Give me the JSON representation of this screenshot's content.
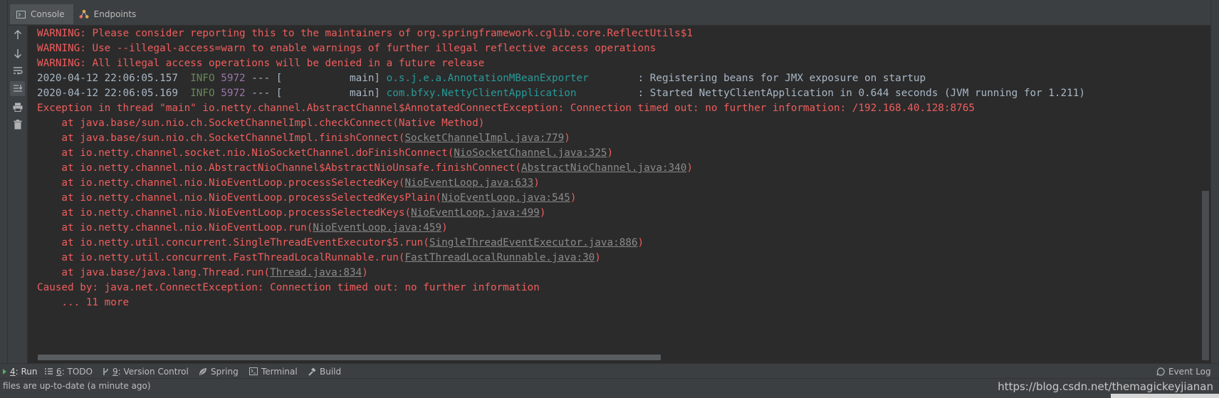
{
  "tabs": [
    {
      "label": "Console",
      "icon": "console-icon"
    },
    {
      "label": "Endpoints",
      "icon": "endpoints-icon"
    }
  ],
  "sidebar_icons": [
    "arrow-up-icon",
    "arrow-down-icon",
    "soft-wrap-icon",
    "scroll-to-end-icon",
    "print-icon",
    "trash-icon"
  ],
  "console_lines": [
    [
      {
        "t": "WARNING: Please consider reporting this to the maintainers of org.springframework.cglib.core.ReflectUtils$1",
        "c": "err"
      }
    ],
    [
      {
        "t": "WARNING: Use --illegal-access=warn to enable warnings of further illegal reflective access operations",
        "c": "err"
      }
    ],
    [
      {
        "t": "WARNING: All illegal access operations will be denied in a future release",
        "c": "err"
      }
    ],
    [
      {
        "t": "2020-04-12 22:06:05.157  ",
        "c": ""
      },
      {
        "t": "INFO",
        "c": "info"
      },
      {
        "t": " ",
        "c": ""
      },
      {
        "t": "5972",
        "c": "pid"
      },
      {
        "t": " --- [           main] ",
        "c": ""
      },
      {
        "t": "o.s.j.e.a.AnnotationMBeanExporter       ",
        "c": "logger"
      },
      {
        "t": " : Registering beans for JMX exposure on startup",
        "c": ""
      }
    ],
    [
      {
        "t": "2020-04-12 22:06:05.169  ",
        "c": ""
      },
      {
        "t": "INFO",
        "c": "info"
      },
      {
        "t": " ",
        "c": ""
      },
      {
        "t": "5972",
        "c": "pid"
      },
      {
        "t": " --- [           main] ",
        "c": ""
      },
      {
        "t": "com.bfxy.NettyClientApplication         ",
        "c": "logger"
      },
      {
        "t": " : Started NettyClientApplication in 0.644 seconds (JVM running for 1.211)",
        "c": ""
      }
    ],
    [
      {
        "t": "Exception in thread \"main\" io.netty.channel.AbstractChannel$AnnotatedConnectException: Connection timed out: no further information: /192.168.40.128:8765",
        "c": "err"
      }
    ],
    [
      {
        "t": "    at java.base/sun.nio.ch.SocketChannelImpl.checkConnect(Native Method)",
        "c": "err"
      }
    ],
    [
      {
        "t": "    at java.base/sun.nio.ch.SocketChannelImpl.finishConnect(",
        "c": "err"
      },
      {
        "t": "SocketChannelImpl.java:779",
        "c": "link"
      },
      {
        "t": ")",
        "c": "err"
      }
    ],
    [
      {
        "t": "    at io.netty.channel.socket.nio.NioSocketChannel.doFinishConnect(",
        "c": "err"
      },
      {
        "t": "NioSocketChannel.java:325",
        "c": "link"
      },
      {
        "t": ")",
        "c": "err"
      }
    ],
    [
      {
        "t": "    at io.netty.channel.nio.AbstractNioChannel$AbstractNioUnsafe.finishConnect(",
        "c": "err"
      },
      {
        "t": "AbstractNioChannel.java:340",
        "c": "link"
      },
      {
        "t": ")",
        "c": "err"
      }
    ],
    [
      {
        "t": "    at io.netty.channel.nio.NioEventLoop.processSelectedKey(",
        "c": "err"
      },
      {
        "t": "NioEventLoop.java:633",
        "c": "link"
      },
      {
        "t": ")",
        "c": "err"
      }
    ],
    [
      {
        "t": "    at io.netty.channel.nio.NioEventLoop.processSelectedKeysPlain(",
        "c": "err"
      },
      {
        "t": "NioEventLoop.java:545",
        "c": "link"
      },
      {
        "t": ")",
        "c": "err"
      }
    ],
    [
      {
        "t": "    at io.netty.channel.nio.NioEventLoop.processSelectedKeys(",
        "c": "err"
      },
      {
        "t": "NioEventLoop.java:499",
        "c": "link"
      },
      {
        "t": ")",
        "c": "err"
      }
    ],
    [
      {
        "t": "    at io.netty.channel.nio.NioEventLoop.run(",
        "c": "err"
      },
      {
        "t": "NioEventLoop.java:459",
        "c": "link"
      },
      {
        "t": ")",
        "c": "err"
      }
    ],
    [
      {
        "t": "    at io.netty.util.concurrent.SingleThreadEventExecutor$5.run(",
        "c": "err"
      },
      {
        "t": "SingleThreadEventExecutor.java:886",
        "c": "link"
      },
      {
        "t": ")",
        "c": "err"
      }
    ],
    [
      {
        "t": "    at io.netty.util.concurrent.FastThreadLocalRunnable.run(",
        "c": "err"
      },
      {
        "t": "FastThreadLocalRunnable.java:30",
        "c": "link"
      },
      {
        "t": ")",
        "c": "err"
      }
    ],
    [
      {
        "t": "    at java.base/java.lang.Thread.run(",
        "c": "err"
      },
      {
        "t": "Thread.java:834",
        "c": "link"
      },
      {
        "t": ")",
        "c": "err"
      }
    ],
    [
      {
        "t": "Caused by: java.net.ConnectException: Connection timed out: no further information",
        "c": "err"
      }
    ],
    [
      {
        "t": "    ... 11 more",
        "c": "err"
      }
    ]
  ],
  "toolwindows": {
    "run": {
      "mnemonic": "4",
      "label": ": Run"
    },
    "todo": {
      "mnemonic": "6",
      "label": ": TODO"
    },
    "vcs": {
      "mnemonic": "9",
      "label": ": Version Control"
    },
    "spring": {
      "label": "Spring"
    },
    "terminal": {
      "label": "Terminal"
    },
    "build": {
      "label": "Build"
    },
    "eventlog": {
      "label": "Event Log"
    }
  },
  "status_text": "files are up-to-date (a minute ago)",
  "watermark": "https://blog.csdn.net/themagickeyjianan",
  "colors": {
    "error": "#f05d5d",
    "info": "#6a8759",
    "pid": "#9876aa",
    "logger": "#299999",
    "link": "#8a8a8a",
    "text": "#a9b7c6",
    "background": "#2b2b2b",
    "panel": "#3c3f41"
  }
}
